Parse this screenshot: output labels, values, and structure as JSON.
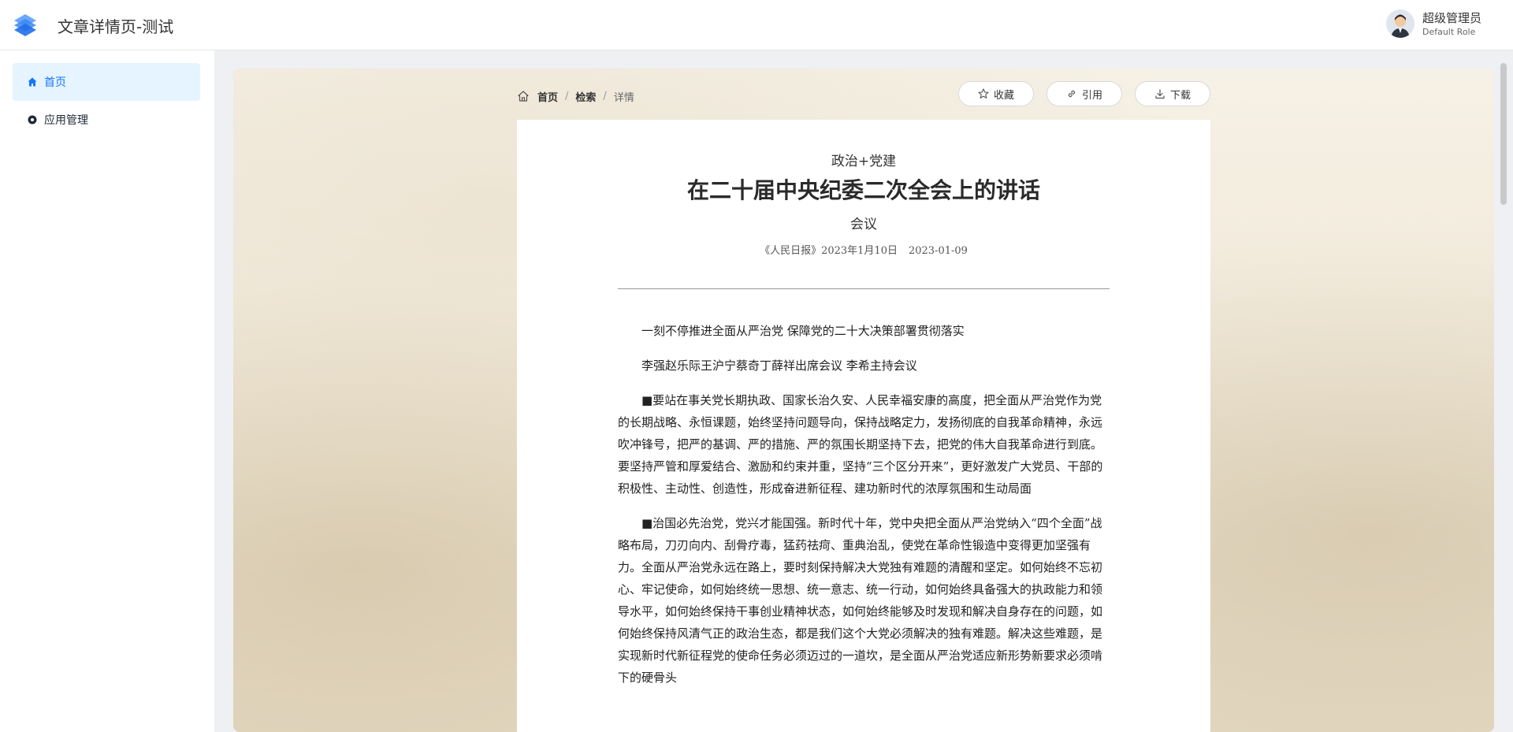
{
  "header": {
    "app_title": "文章详情页-测试",
    "user_name": "超级管理员",
    "user_role": "Default Role"
  },
  "sidebar": {
    "items": [
      {
        "label": "首页",
        "icon": "home-icon",
        "active": true
      },
      {
        "label": "应用管理",
        "icon": "app-icon",
        "active": false
      }
    ]
  },
  "breadcrumb": {
    "items": [
      "首页",
      "检索",
      "详情"
    ],
    "separator": "/"
  },
  "actions": {
    "collect_label": "收藏",
    "cite_label": "引用",
    "download_label": "下载"
  },
  "article": {
    "category": "政治+党建",
    "title": "在二十届中央纪委二次全会上的讲话",
    "subtitle": "会议",
    "source": "《人民日报》2023年1月10日",
    "date": "2023-01-09",
    "paragraphs": [
      "一刻不停推进全面从严治党 保障党的二十大决策部署贯彻落实",
      "李强赵乐际王沪宁蔡奇丁薛祥出席会议 李希主持会议",
      "■要站在事关党长期执政、国家长治久安、人民幸福安康的高度，把全面从严治党作为党的长期战略、永恒课题，始终坚持问题导向，保持战略定力，发扬彻底的自我革命精神，永远吹冲锋号，把严的基调、严的措施、严的氛围长期坚持下去，把党的伟大自我革命进行到底。要坚持严管和厚爱结合、激励和约束并重，坚持“三个区分开来”，更好激发广大党员、干部的积极性、主动性、创造性，形成奋进新征程、建功新时代的浓厚氛围和生动局面",
      "■治国必先治党，党兴才能国强。新时代十年，党中央把全面从严治党纳入“四个全面”战略布局，刀刃向内、刮骨疗毒，猛药祛疴、重典治乱，使党在革命性锻造中变得更加坚强有力。全面从严治党永远在路上，要时刻保持解决大党独有难题的清醒和坚定。如何始终不忘初心、牢记使命，如何始终统一思想、统一意志、统一行动，如何始终具备强大的执政能力和领导水平，如何始终保持干事创业精神状态，如何始终能够及时发现和解决自身存在的问题，如何始终保持风清气正的政治生态，都是我们这个大党必须解决的独有难题。解决这些难题，是实现新时代新征程党的使命任务必须迈过的一道坎，是全面从严治党适应新形势新要求必须啃下的硬骨头"
    ]
  },
  "colors": {
    "accent": "#1677ff",
    "active_bg": "#e6f4ff",
    "logo_blue": "#2f7cf6"
  }
}
